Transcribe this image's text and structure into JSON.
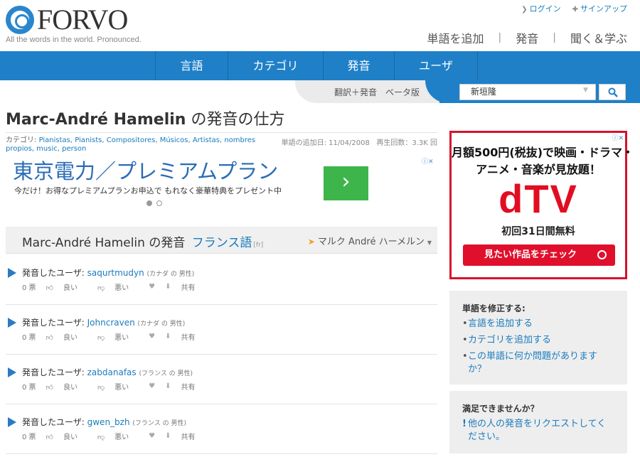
{
  "logo": {
    "text": "FORVO",
    "tagline": "All the words in the world. Pronounced."
  },
  "user_links": {
    "login": "ログイン",
    "signup": "サインアップ"
  },
  "top_nav": {
    "add_word": "単語を追加",
    "pronounce": "発音",
    "listen_learn": "聞く＆学ぶ"
  },
  "main_tabs": [
    "言語",
    "カテゴリ",
    "発音",
    "ユーザ"
  ],
  "beta": "翻訳＋発音　ベータ版",
  "search": {
    "value": "新垣隆"
  },
  "title": {
    "word": "Marc-André Hamelin",
    "suffix": " の発音の仕方"
  },
  "meta": {
    "categories_label": "カテゴリ: ",
    "categories": "Pianistas, Pianists, Compositores, Músicos, Artistas, nombres propios, music, person",
    "date_label": "単語の追加日: ",
    "date": "11/04/2008",
    "plays_label": "再生回数：",
    "plays": "3.3K 回"
  },
  "ad_top": {
    "title": "東京電力／プレミアムプラン",
    "subtitle": "今だけ！お得なプレミアムプランお申込で もれなく豪華特典をプレゼント中",
    "go": "›"
  },
  "pron_section": {
    "word": "Marc-André Hamelin",
    "mid": " の発音 ",
    "language": "フランス語",
    "code": "[fr]",
    "transliteration": "マルク André ハーメルン"
  },
  "pronunciations": [
    {
      "prefix": "発音したユーザ: ",
      "user": "saqurtmudyn",
      "info": "(カナダ の 男性)",
      "votes": "0 票",
      "good": "良い",
      "bad": "悪い",
      "share": "共有"
    },
    {
      "prefix": "発音したユーザ: ",
      "user": "Johncraven",
      "info": "(カナダ の 男性)",
      "votes": "0 票",
      "good": "良い",
      "bad": "悪い",
      "share": "共有"
    },
    {
      "prefix": "発音したユーザ: ",
      "user": "zabdanafas",
      "info": "(フランス の 男性)",
      "votes": "0 票",
      "good": "良い",
      "bad": "悪い",
      "share": "共有"
    },
    {
      "prefix": "発音したユーザ: ",
      "user": "gwen_bzh",
      "info": "(フランス の 男性)",
      "votes": "0 票",
      "good": "良い",
      "bad": "悪い",
      "share": "共有"
    }
  ],
  "ad_right": {
    "line1": "月額500円(税抜)で映画・ドラマ・",
    "line2": "アニメ・音楽が見放題！",
    "brand": "dTV",
    "trial": "初回31日間無料",
    "cta": "見たい作品をチェック"
  },
  "fix_box": {
    "title": "単語を修正する:",
    "items": [
      "言語を追加する",
      "カテゴリを追加する",
      "この単語に何か問題がありますか？"
    ]
  },
  "request_box": {
    "title": "満足できませんか？",
    "item": "他の人の発音をリクエストしてください。"
  },
  "colors": {
    "brand_blue": "#1f80c8",
    "link": "#1a7bbd",
    "ad_red": "#e20d22",
    "ad_green": "#3db54a"
  }
}
